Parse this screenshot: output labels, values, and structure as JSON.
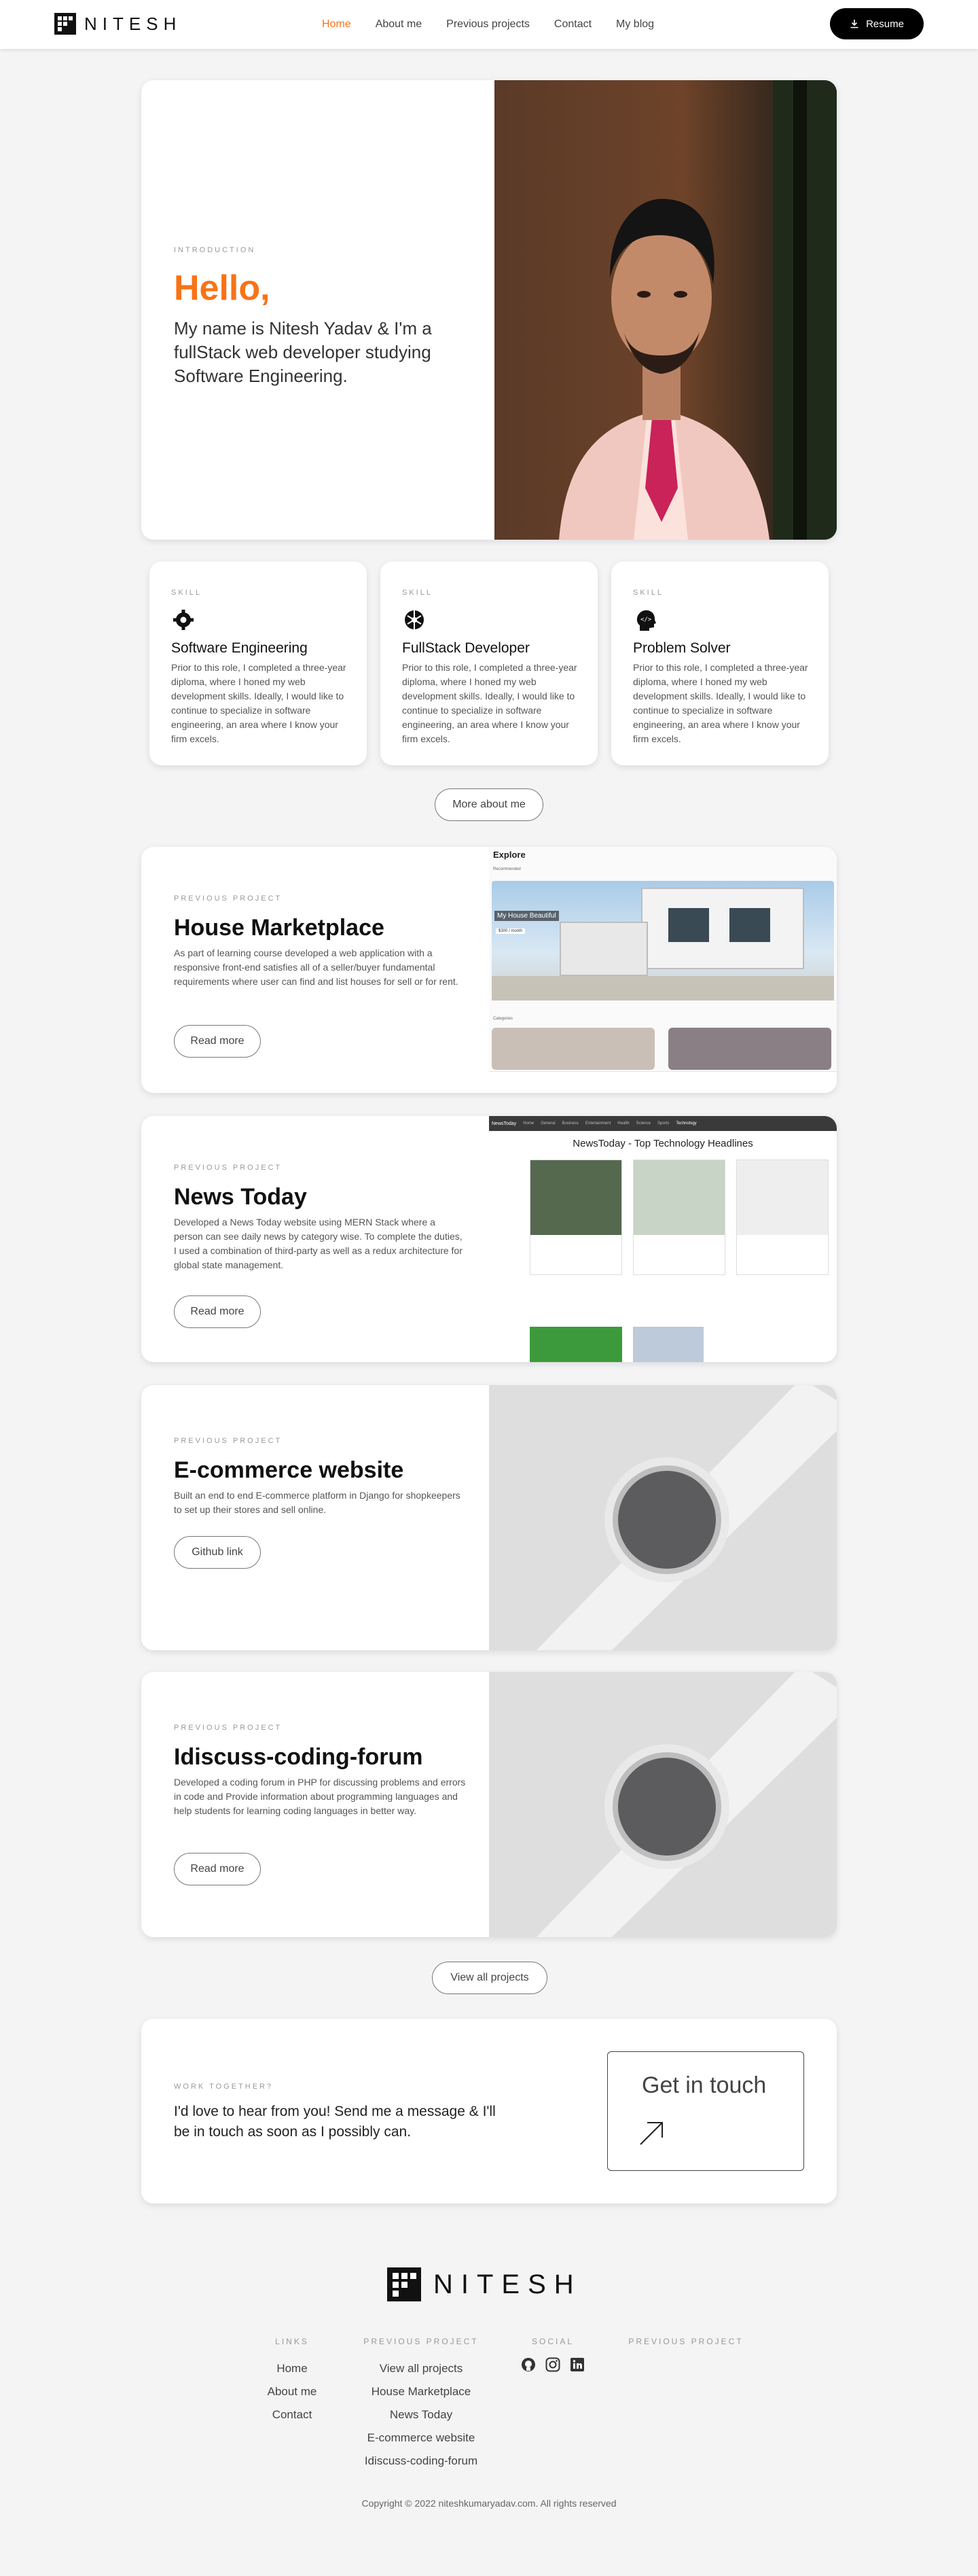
{
  "nav": {
    "logo": "NITESH",
    "links": [
      "Home",
      "About me",
      "Previous projects",
      "Contact",
      "My blog"
    ],
    "resume": "Resume"
  },
  "hero": {
    "eyebrow": "INTRODUCTION",
    "greeting": "Hello,",
    "text": "My name is Nitesh Yadav & I'm a fullStack web developer studying Software Engineering."
  },
  "skills": [
    {
      "eyebrow": "SKILL",
      "icon": "gear-icon",
      "title": "Software Engineering",
      "text": "Prior to this role, I completed a three-year diploma, where I honed my web development skills. Ideally, I would like to continue to specialize in software engineering, an area where I know your firm excels."
    },
    {
      "eyebrow": "SKILL",
      "icon": "network-icon",
      "title": "FullStack Developer",
      "text": "Prior to this role, I completed a three-year diploma, where I honed my web development skills. Ideally, I would like to continue to specialize in software engineering, an area where I know your firm excels."
    },
    {
      "eyebrow": "SKILL",
      "icon": "head-code-icon",
      "title": "Problem Solver",
      "text": "Prior to this role, I completed a three-year diploma, where I honed my web development skills. Ideally, I would like to continue to specialize in software engineering, an area where I know your firm excels."
    }
  ],
  "more_about": "More about me",
  "projects": [
    {
      "eyebrow": "PREVIOUS PROJECT",
      "title": "House Marketplace",
      "text": "As part of learning course developed a web application with a responsive front-end satisfies all of a seller/buyer fundamental requirements where user can find and list houses for sell or for rent.",
      "button": "Read more",
      "shot": {
        "heading": "Explore",
        "sub": "Recommended",
        "tag": "My House Beautiful",
        "price": "$300 / month",
        "sub2": "Categories"
      }
    },
    {
      "eyebrow": "PREVIOUS PROJECT",
      "title": "News Today",
      "text": "Developed a News Today website using MERN Stack where a person can see daily news by category wise. To complete the duties, I used a combination of third-party as well as a redux architecture for global state management.",
      "button": "Read more",
      "shot": {
        "brand": "NewsToday",
        "menu": [
          "Home",
          "General",
          "Business",
          "Entertainment",
          "Health",
          "Science",
          "Sports",
          "Technology"
        ],
        "headline": "NewsToday - Top Technology Headlines"
      }
    },
    {
      "eyebrow": "PREVIOUS PROJECT",
      "title": "E-commerce website",
      "text": "Built an end to end E-commerce platform in Django for shopkeepers to set up their stores and sell online.",
      "button": "Github link"
    },
    {
      "eyebrow": "PREVIOUS PROJECT",
      "title": "Idiscuss-coding-forum",
      "text": "Developed a coding forum in PHP for discussing problems and errors in code and Provide information about programming languages and help students for learning coding languages in better way.",
      "button": "Read more"
    }
  ],
  "view_all": "View all projects",
  "contact": {
    "eyebrow": "WORK TOGETHER?",
    "text": "I'd love to hear from you! Send me a message & I'll be in touch as soon as I possibly can.",
    "button": "Get in touch"
  },
  "footer": {
    "logo": "NITESH",
    "links_heading": "LINKS",
    "links": [
      "Home",
      "About me",
      "Contact"
    ],
    "projects_heading": "PREVIOUS PROJECT",
    "projects": [
      "View all projects",
      "House Marketplace",
      "News Today",
      "E-commerce website",
      "Idiscuss-coding-forum"
    ],
    "social_heading": "SOCIAL",
    "social_icons": [
      "github-icon",
      "instagram-icon",
      "linkedin-icon"
    ],
    "extra_heading": "PREVIOUS PROJECT",
    "copyright": "Copyright © 2022 niteshkumaryadav.com. All rights reserved"
  },
  "colors": {
    "accent": "#f97316",
    "dark": "#000000",
    "background": "#f4f4f5"
  }
}
